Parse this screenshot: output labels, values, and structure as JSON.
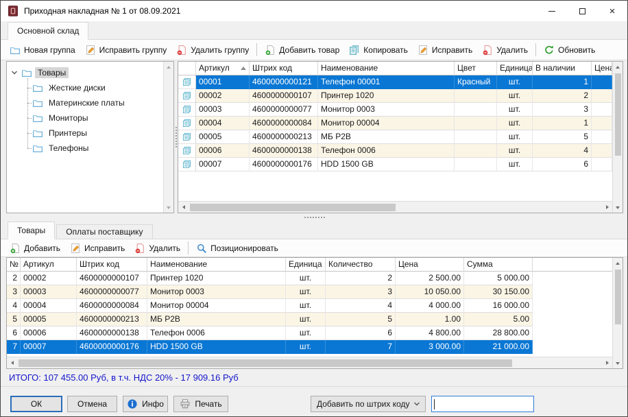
{
  "window": {
    "title": "Приходная накладная № 1 от 08.09.2021",
    "controls": {
      "minimize": "minimize",
      "maximize": "maximize",
      "close": "close"
    }
  },
  "warehouse_tabs": [
    {
      "label": "Основной склад",
      "active": true
    }
  ],
  "top_toolbar": {
    "groups": [
      {
        "buttons": [
          {
            "label": "Новая группа",
            "icon": "new-folder-icon"
          },
          {
            "label": "Исправить группу",
            "icon": "edit-pencil-icon"
          },
          {
            "label": "Удалить группу",
            "icon": "delete-doc-icon"
          }
        ]
      },
      {
        "buttons": [
          {
            "label": "Добавить товар",
            "icon": "add-doc-icon"
          },
          {
            "label": "Копировать",
            "icon": "copy-icon"
          },
          {
            "label": "Исправить",
            "icon": "edit-pencil-icon"
          },
          {
            "label": "Удалить",
            "icon": "delete-doc-icon"
          }
        ]
      },
      {
        "buttons": [
          {
            "label": "Обновить",
            "icon": "refresh-icon"
          }
        ]
      }
    ]
  },
  "tree": {
    "root": {
      "label": "Товары",
      "selected": true,
      "expanded": true
    },
    "children": [
      {
        "label": "Жесткие диски"
      },
      {
        "label": "Материнские платы"
      },
      {
        "label": "Мониторы"
      },
      {
        "label": "Принтеры"
      },
      {
        "label": "Телефоны"
      }
    ]
  },
  "products_grid": {
    "columns": [
      "Артикул",
      "Штрих код",
      "Наименование",
      "Цвет",
      "Единица",
      "В наличии",
      "Цена"
    ],
    "sorted_column": "Артикул",
    "sort_direction": "asc",
    "rows": [
      {
        "selected": true,
        "cells": [
          "00001",
          "4600000000121",
          "Телефон 00001",
          "Красный",
          "шт.",
          "1",
          ""
        ]
      },
      {
        "cells": [
          "00002",
          "4600000000107",
          "Принтер 1020",
          "",
          "шт.",
          "2",
          ""
        ]
      },
      {
        "cells": [
          "00003",
          "4600000000077",
          "Монитор 0003",
          "",
          "шт.",
          "3",
          ""
        ]
      },
      {
        "cells": [
          "00004",
          "4600000000084",
          "Монитор 00004",
          "",
          "шт.",
          "1",
          ""
        ]
      },
      {
        "cells": [
          "00005",
          "4600000000213",
          "МБ P2B",
          "",
          "шт.",
          "5",
          ""
        ]
      },
      {
        "cells": [
          "00006",
          "4600000000138",
          "Телефон 0006",
          "",
          "шт.",
          "4",
          ""
        ]
      },
      {
        "cells": [
          "00007",
          "4600000000176",
          "HDD 1500 GB",
          "",
          "шт.",
          "6",
          ""
        ]
      }
    ]
  },
  "detail_tabs": [
    {
      "label": "Товары",
      "active": true
    },
    {
      "label": "Оплаты поставщику",
      "active": false
    }
  ],
  "bottom_toolbar": {
    "groups": [
      {
        "buttons": [
          {
            "label": "Добавить",
            "icon": "add-doc-icon"
          },
          {
            "label": "Исправить",
            "icon": "edit-pencil-icon"
          },
          {
            "label": "Удалить",
            "icon": "delete-doc-icon"
          }
        ]
      },
      {
        "buttons": [
          {
            "label": "Позиционировать",
            "icon": "search-icon"
          }
        ]
      }
    ]
  },
  "invoice_grid": {
    "columns": [
      "№",
      "Артикул",
      "Штрих код",
      "Наименование",
      "Единица",
      "Количество",
      "Цена",
      "Сумма"
    ],
    "rows": [
      {
        "cells": [
          "2",
          "00002",
          "4600000000107",
          "Принтер 1020",
          "шт.",
          "2",
          "2 500.00",
          "5 000.00"
        ]
      },
      {
        "cells": [
          "3",
          "00003",
          "4600000000077",
          "Монитор 0003",
          "шт.",
          "3",
          "10 050.00",
          "30 150.00"
        ]
      },
      {
        "cells": [
          "4",
          "00004",
          "4600000000084",
          "Монитор 00004",
          "шт.",
          "4",
          "4 000.00",
          "16 000.00"
        ]
      },
      {
        "cells": [
          "5",
          "00005",
          "4600000000213",
          "МБ P2B",
          "шт.",
          "5",
          "1.00",
          "5.00"
        ]
      },
      {
        "cells": [
          "6",
          "00006",
          "4600000000138",
          "Телефон 0006",
          "шт.",
          "6",
          "4 800.00",
          "28 800.00"
        ]
      },
      {
        "selected": true,
        "cells": [
          "7",
          "00007",
          "4600000000176",
          "HDD 1500 GB",
          "шт.",
          "7",
          "3 000.00",
          "21 000.00"
        ]
      }
    ]
  },
  "totals": {
    "text": "ИТОГО: 107 455.00 Руб, в т.ч. НДС 20% - 17 909.16 Руб"
  },
  "footer": {
    "ok": "ОК",
    "cancel": "Отмена",
    "info": "Инфо",
    "print": "Печать",
    "barcode_mode": "Добавить по штрих коду",
    "barcode_value": ""
  },
  "colors": {
    "selection": "#0a77d4",
    "alt_row": "#fbf5e6",
    "tree_selection": "#d6d6d6",
    "total_text": "#1414cc",
    "focus_border": "#2c7cd9"
  }
}
